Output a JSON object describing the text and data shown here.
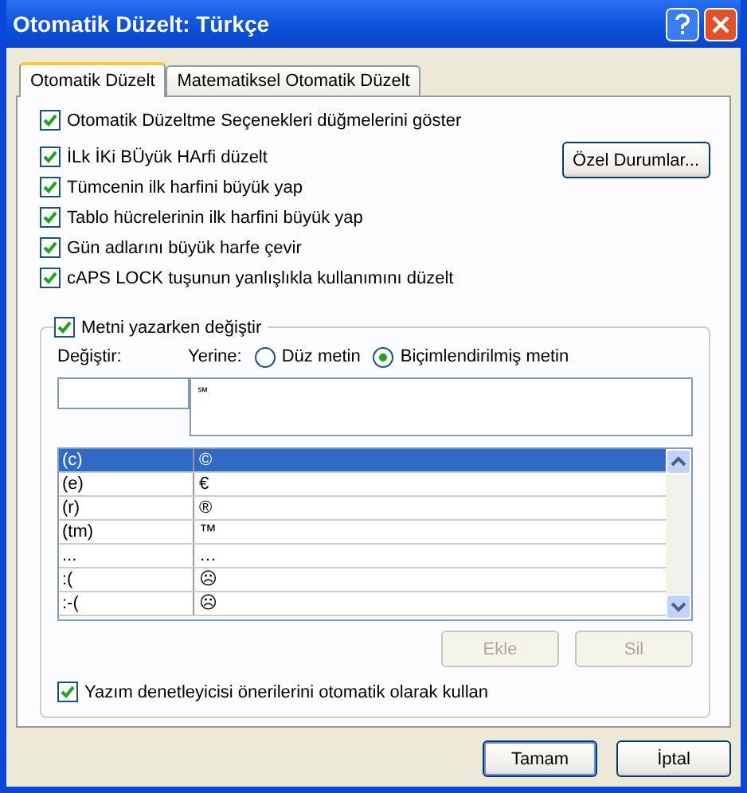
{
  "window": {
    "title": "Otomatik Düzelt: Türkçe"
  },
  "tabs": [
    {
      "label": "Otomatik Düzelt",
      "selected": true
    },
    {
      "label": "Matematiksel Otomatik Düzelt",
      "selected": false
    }
  ],
  "show_buttons_option": {
    "label": "Otomatik Düzeltme Seçenekleri düğmelerini göster",
    "checked": true
  },
  "capital_options": [
    {
      "label": "İLk İKi BÜyük HArfi düzelt",
      "checked": true
    },
    {
      "label": "Tümcenin ilk harfini büyük yap",
      "checked": true
    },
    {
      "label": "Tablo hücrelerinin ilk harfini büyük yap",
      "checked": true
    },
    {
      "label": "Gün adlarını büyük harfe çevir",
      "checked": true
    },
    {
      "label": "cAPS LOCK tuşunun yanlışlıkla kullanımını düzelt",
      "checked": true
    }
  ],
  "exceptions_button": {
    "label": "Özel Durumlar..."
  },
  "replace_group": {
    "label": "Metni yazarken değiştir",
    "checked": true,
    "replace_label": "Değiştir:",
    "with_label": "Yerine:",
    "with_value": "℠",
    "format_options": [
      {
        "label": "Düz metin",
        "selected": false
      },
      {
        "label": "Biçimlendirilmiş metin",
        "selected": true
      }
    ]
  },
  "table": {
    "rows": [
      {
        "replace": "(c)",
        "with": "©",
        "selected": true
      },
      {
        "replace": "(e)",
        "with": "€",
        "selected": false
      },
      {
        "replace": "(r)",
        "with": "®",
        "selected": false
      },
      {
        "replace": "(tm)",
        "with": "™",
        "selected": false
      },
      {
        "replace": "...",
        "with": "…",
        "selected": false
      },
      {
        "replace": ":(",
        "with": "☹",
        "selected": false
      },
      {
        "replace": ":-(",
        "with": "☹",
        "selected": false
      }
    ]
  },
  "action_buttons": [
    {
      "label": "Ekle",
      "disabled": true
    },
    {
      "label": "Sil",
      "disabled": true
    }
  ],
  "spell_option": {
    "label": "Yazım denetleyicisi önerilerini otomatik olarak kullan",
    "checked": true
  },
  "footer_buttons": [
    {
      "label": "Tamam",
      "default": true
    },
    {
      "label": "İptal",
      "default": false
    }
  ]
}
